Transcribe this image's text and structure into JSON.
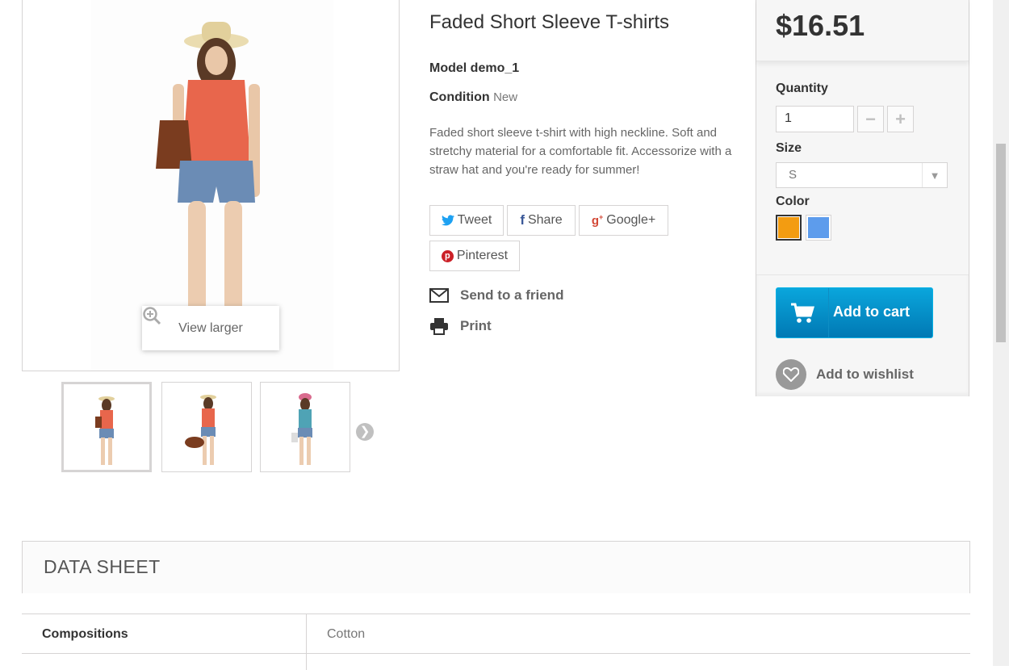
{
  "product": {
    "title": "Faded Short Sleeve T-shirts",
    "model_label": "Model",
    "model_value": "demo_1",
    "condition_label": "Condition",
    "condition_value": "New",
    "description": "Faded short sleeve t-shirt with high neckline. Soft and stretchy material for a comfortable fit. Accessorize with a straw hat and you're ready for summer!"
  },
  "gallery": {
    "view_larger": "View larger",
    "thumb_count": 3
  },
  "share": {
    "tweet": "Tweet",
    "share": "Share",
    "google": "Google+",
    "pinterest": "Pinterest"
  },
  "links": {
    "send_friend": "Send to a friend",
    "print": "Print"
  },
  "buy": {
    "price": "$16.51",
    "quantity_label": "Quantity",
    "quantity_value": "1",
    "size_label": "Size",
    "size_value": "S",
    "color_label": "Color",
    "colors": [
      "#f39c11",
      "#5d9cec"
    ],
    "add_to_cart": "Add to cart",
    "add_to_wishlist": "Add to wishlist"
  },
  "data_sheet": {
    "title": "DATA SHEET",
    "rows": [
      {
        "key": "Compositions",
        "value": "Cotton"
      }
    ]
  }
}
